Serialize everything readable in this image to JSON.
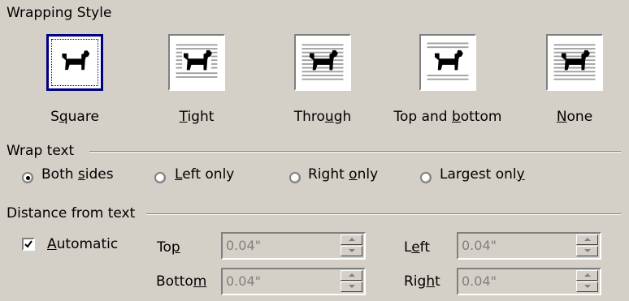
{
  "wrapping_style": {
    "heading": "Wrapping Style",
    "selected": "Square",
    "options": [
      {
        "pre": "S",
        "acc": "q",
        "post": "uare"
      },
      {
        "pre": "",
        "acc": "T",
        "post": "ight"
      },
      {
        "pre": "Thro",
        "acc": "u",
        "post": "gh"
      },
      {
        "pre": "Top and ",
        "acc": "b",
        "post": "ottom"
      },
      {
        "pre": "",
        "acc": "N",
        "post": "one"
      }
    ],
    "icon": "dog-silhouette-icon"
  },
  "wrap_text": {
    "heading": "Wrap text",
    "selected": "Both sides",
    "options": [
      {
        "pre": "Both ",
        "acc": "s",
        "post": "ides"
      },
      {
        "pre": "",
        "acc": "L",
        "post": "eft only"
      },
      {
        "pre": "Right ",
        "acc": "o",
        "post": "nly"
      },
      {
        "pre": "Largest onl",
        "acc": "y",
        "post": ""
      }
    ]
  },
  "distance": {
    "heading": "Distance from text",
    "automatic": {
      "pre": "",
      "acc": "A",
      "post": "utomatic",
      "checked": true
    },
    "top": {
      "pre": "To",
      "acc": "p",
      "post": "",
      "value": "0.04\""
    },
    "bottom": {
      "pre": "Botto",
      "acc": "m",
      "post": "",
      "value": "0.04\""
    },
    "left": {
      "pre": "L",
      "acc": "e",
      "post": "ft",
      "value": "0.04\""
    },
    "right": {
      "pre": "Rig",
      "acc": "h",
      "post": "t",
      "value": "0.04\""
    }
  },
  "colors": {
    "face": "#d4d0c8",
    "focus": "#000080",
    "disabled_text": "#808080"
  }
}
